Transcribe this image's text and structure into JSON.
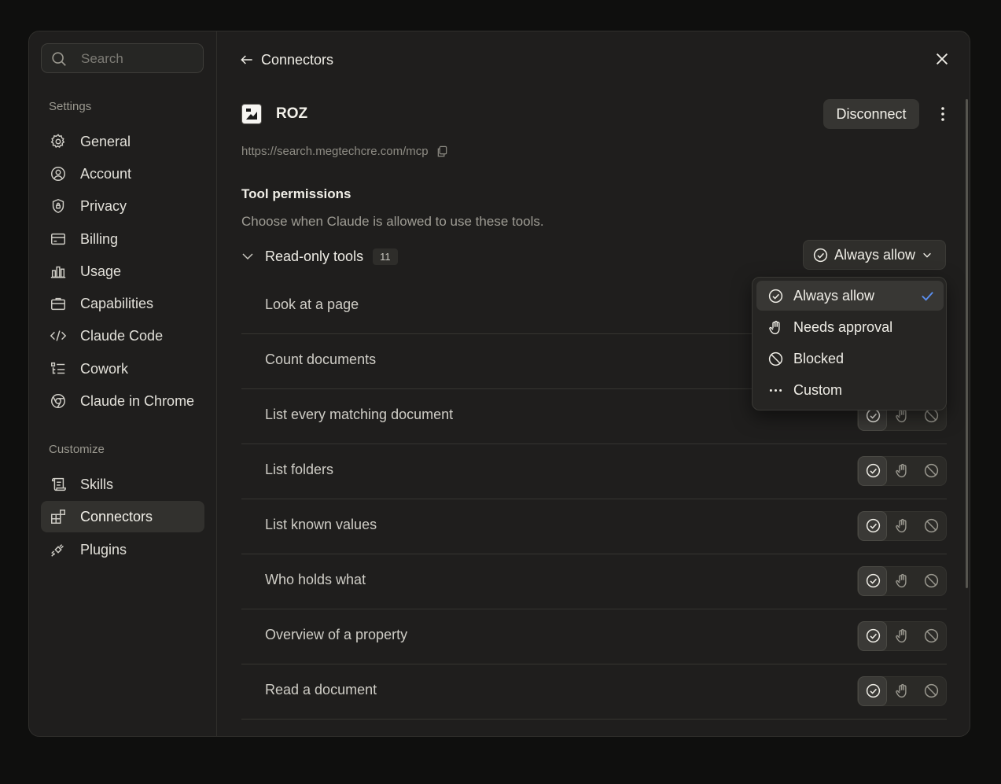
{
  "sidebar": {
    "search_placeholder": "Search",
    "settings_label": "Settings",
    "settings_items": [
      {
        "label": "General",
        "icon": "gear-icon"
      },
      {
        "label": "Account",
        "icon": "user-circle-icon"
      },
      {
        "label": "Privacy",
        "icon": "shield-icon"
      },
      {
        "label": "Billing",
        "icon": "credit-card-icon"
      },
      {
        "label": "Usage",
        "icon": "bar-chart-icon"
      },
      {
        "label": "Capabilities",
        "icon": "briefcase-icon"
      },
      {
        "label": "Claude Code",
        "icon": "code-icon"
      },
      {
        "label": "Cowork",
        "icon": "checklist-icon"
      },
      {
        "label": "Claude in Chrome",
        "icon": "chrome-icon"
      }
    ],
    "customize_label": "Customize",
    "customize_items": [
      {
        "label": "Skills",
        "icon": "scroll-icon"
      },
      {
        "label": "Connectors",
        "icon": "blocks-icon",
        "active": true
      },
      {
        "label": "Plugins",
        "icon": "plug-icon"
      }
    ]
  },
  "header": {
    "back_label": "Connectors"
  },
  "connector": {
    "name": "ROZ",
    "url": "https://search.megtechcre.com/mcp",
    "disconnect_label": "Disconnect"
  },
  "permissions": {
    "title": "Tool permissions",
    "description": "Choose when Claude is allowed to use these tools.",
    "group_label": "Read-only tools",
    "group_count": "11",
    "group_setting": "Always allow",
    "tools": [
      "Look at a page",
      "Count documents",
      "List every matching document",
      "List folders",
      "List known values",
      "Who holds what",
      "Overview of a property",
      "Read a document"
    ]
  },
  "dropdown": {
    "options": [
      {
        "label": "Always allow",
        "icon": "check-circle-icon",
        "selected": true
      },
      {
        "label": "Needs approval",
        "icon": "hand-icon"
      },
      {
        "label": "Blocked",
        "icon": "blocked-icon"
      },
      {
        "label": "Custom",
        "icon": "more-horizontal-icon"
      }
    ]
  },
  "colors": {
    "background": "#0f0f0e",
    "panel": "#1f1e1d",
    "accent_check": "#5b8ff0"
  }
}
